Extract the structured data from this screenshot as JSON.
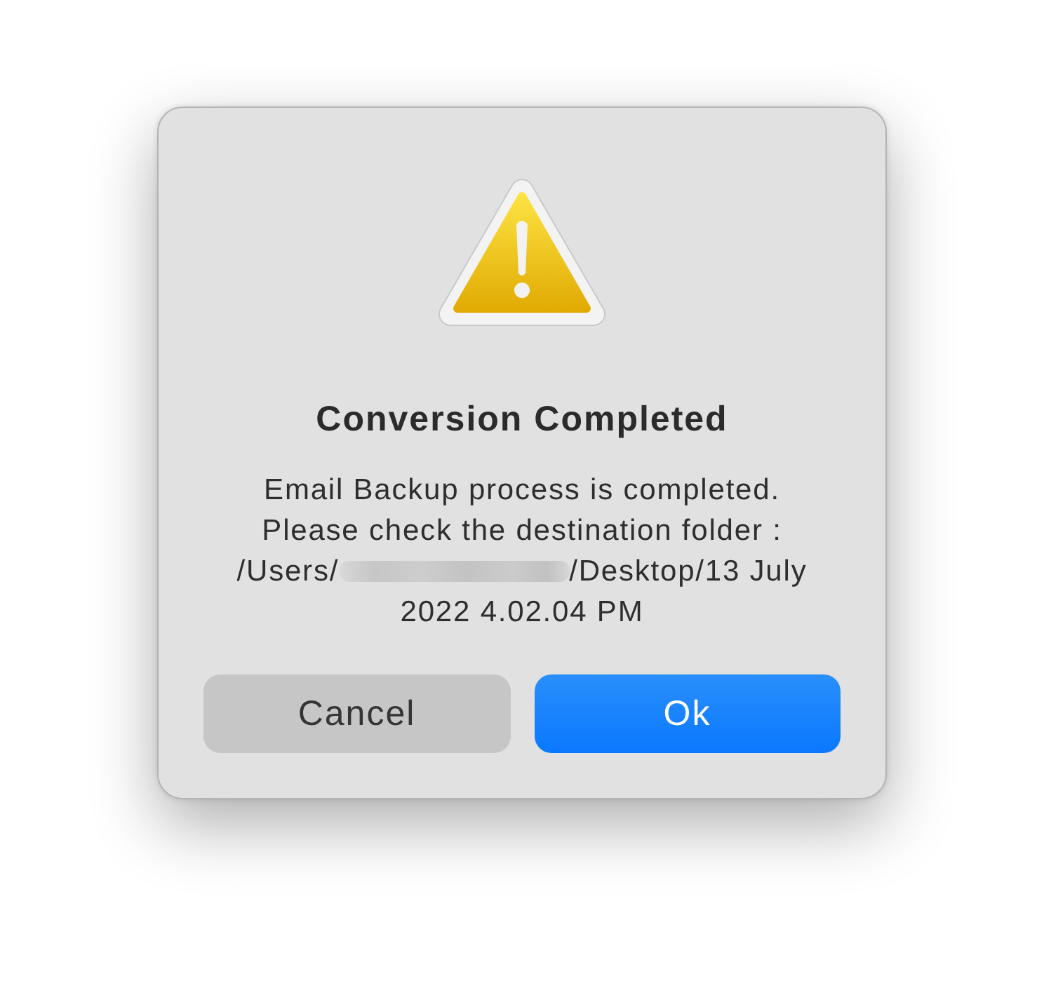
{
  "dialog": {
    "title": "Conversion Completed",
    "message": {
      "before": "Email Backup process is completed. Please check the destination folder : /Users/",
      "redacted": true,
      "after": "/Desktop/13 July 2022 4.02.04 PM"
    },
    "buttons": [
      {
        "label": "Cancel",
        "kind": "cancel"
      },
      {
        "label": "Ok",
        "kind": "confirm"
      }
    ]
  }
}
